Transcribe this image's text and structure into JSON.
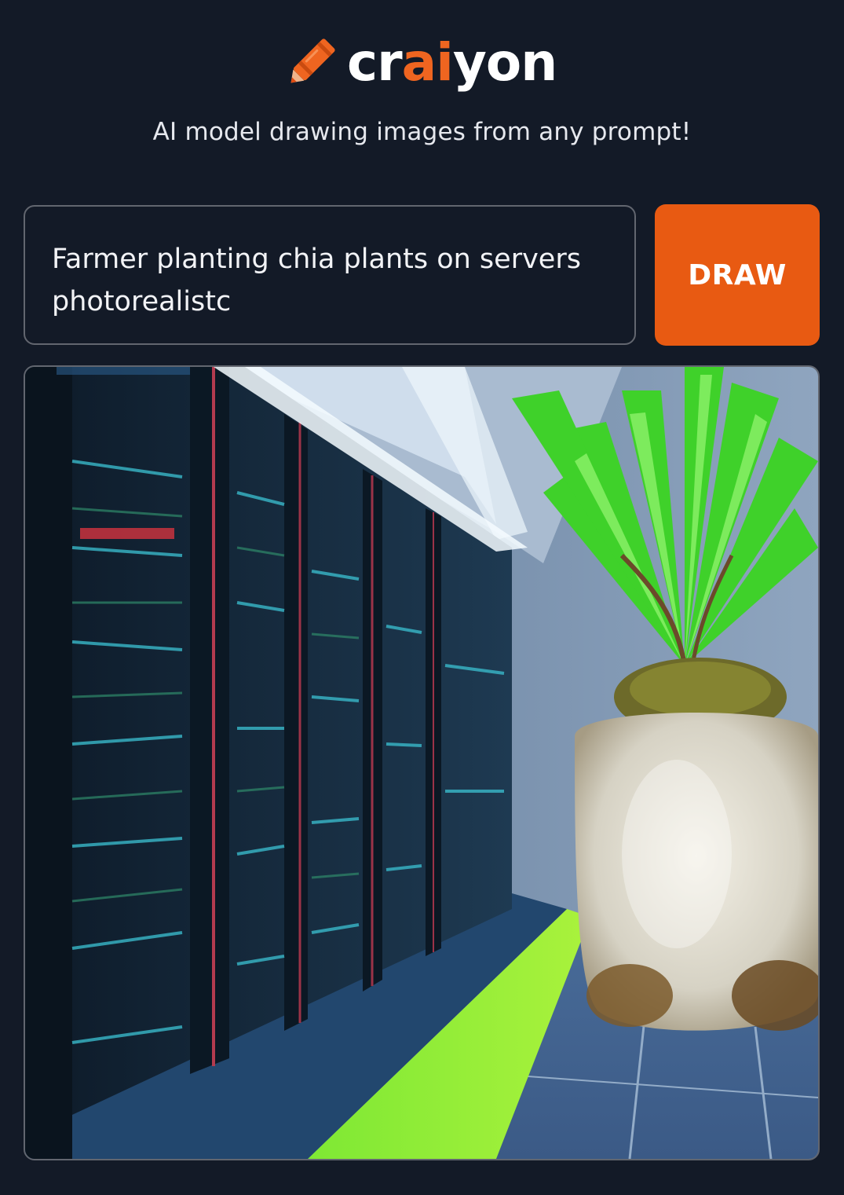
{
  "header": {
    "brand": {
      "prefix": "cr",
      "accent": "ai",
      "suffix": "yon"
    },
    "tagline": "AI model drawing images from any prompt!"
  },
  "prompt": {
    "value": "Farmer planting chia plants on servers photorealistc"
  },
  "draw_button": {
    "label": "DRAW"
  },
  "colors": {
    "background": "#131a27",
    "accent": "#e85a12",
    "border": "#62666f"
  },
  "icons": {
    "logo": "crayon-icon"
  }
}
